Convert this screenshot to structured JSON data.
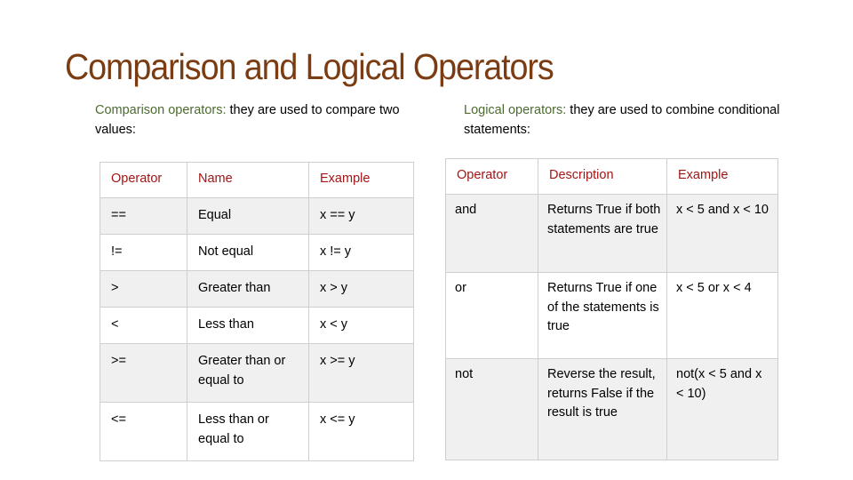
{
  "title": "Comparison and Logical Operators",
  "comparison": {
    "intro_lead": "Comparison operators:",
    "intro_text": "  they are used to compare two values:",
    "headers": [
      "Operator",
      "Name",
      "Example"
    ],
    "rows": [
      {
        "operator": "==",
        "name": "Equal",
        "example": "x == y"
      },
      {
        "operator": "!=",
        "name": "Not equal",
        "example": "x != y"
      },
      {
        "operator": ">",
        "name": "Greater than",
        "example": "x > y"
      },
      {
        "operator": "<",
        "name": "Less than",
        "example": "x < y"
      },
      {
        "operator": ">=",
        "name": "Greater than or equal to",
        "example": "x >= y"
      },
      {
        "operator": "<=",
        "name": "Less than or equal to",
        "example": "x <= y"
      }
    ]
  },
  "logical": {
    "intro_lead": "Logical operators:",
    "intro_text": " they are used to combine conditional statements:",
    "headers": [
      "Operator",
      "Description",
      "Example"
    ],
    "rows": [
      {
        "operator": "and",
        "description": "Returns True if both statements are true",
        "example": "x < 5 and  x < 10"
      },
      {
        "operator": "or",
        "description": "Returns True if one of the statements is true",
        "example": "x < 5 or x < 4"
      },
      {
        "operator": "not",
        "description": "Reverse the result, returns False if the result is true",
        "example": "not(x < 5 and x < 10)"
      }
    ]
  },
  "colors": {
    "title": "#7b3c12",
    "intro_lead": "#4b6b2f",
    "table_header": "#a31515",
    "row_shade": "#f0f0f0",
    "border": "#cfcfcf"
  }
}
